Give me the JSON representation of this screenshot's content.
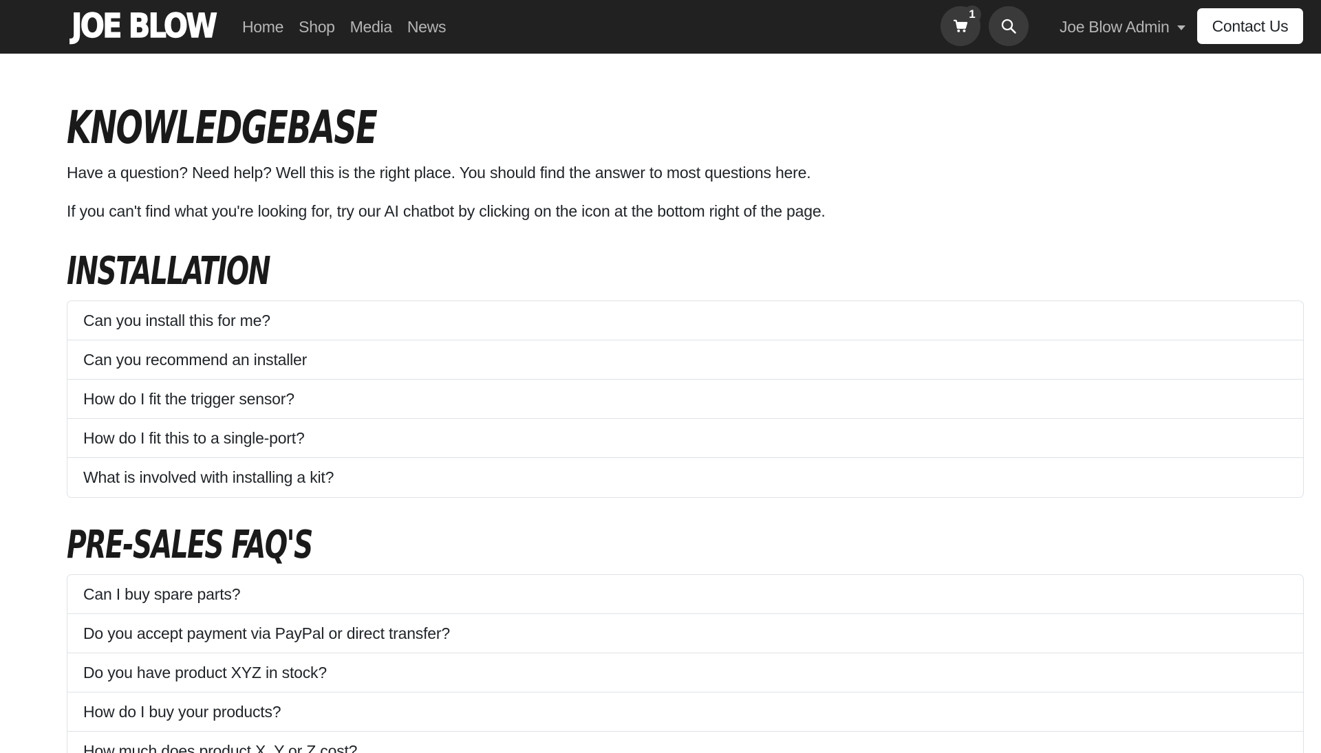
{
  "navbar": {
    "logo": "JOE BLOW",
    "links": [
      "Home",
      "Shop",
      "Media",
      "News"
    ],
    "cart_count": "1",
    "user": "Joe Blow Admin",
    "contact": "Contact Us"
  },
  "page": {
    "title": "Knowledgebase",
    "intro_1": "Have a question? Need help? Well this is the right place. You should find the answer to most questions here.",
    "intro_2": "If you can't find what you're looking for, try our AI chatbot by clicking on the icon at the bottom right of the page."
  },
  "sections": [
    {
      "title": "Installation",
      "questions": [
        "Can you install this for me?",
        "Can you recommend an installer",
        "How do I fit the trigger sensor?",
        "How do I fit this to a single-port?",
        "What is involved with installing a kit?"
      ]
    },
    {
      "title": "Pre-Sales FAQ's",
      "questions": [
        "Can I buy spare parts?",
        "Do you accept payment via PayPal or direct transfer?",
        "Do you have product XYZ in stock?",
        "How do I buy your products?",
        "How much does product X, Y or Z cost?"
      ]
    }
  ],
  "icons": {
    "cart": "shopping-cart-icon",
    "search": "search-icon",
    "dropdown": "caret-down-icon"
  }
}
